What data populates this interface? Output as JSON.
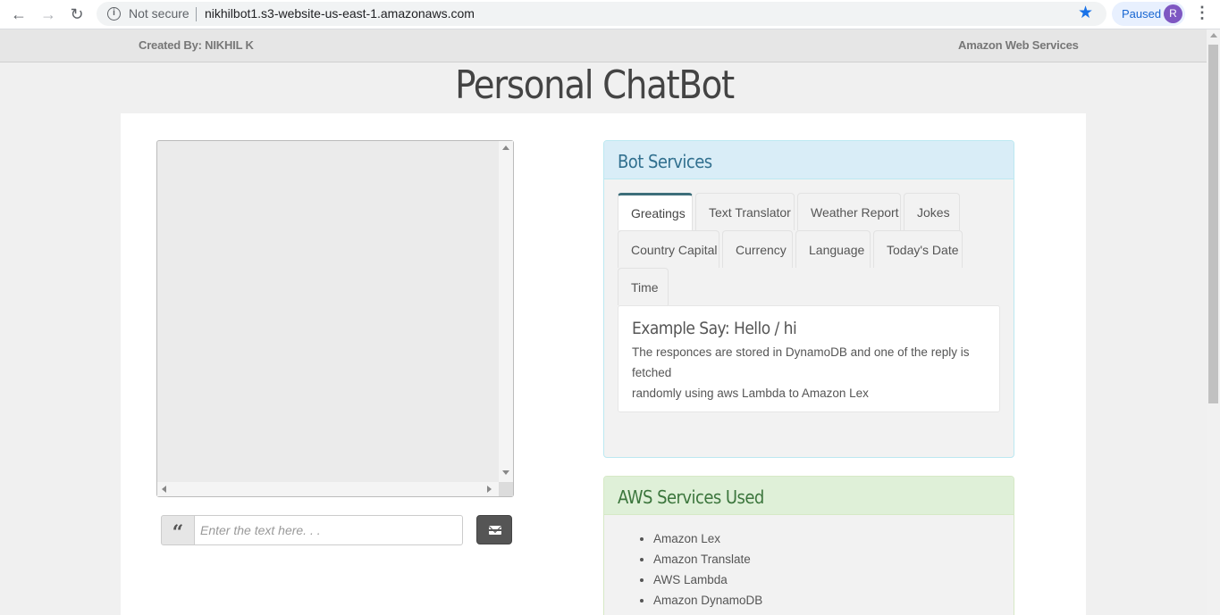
{
  "browser": {
    "security_label": "Not secure",
    "url": "nikhilbot1.s3-website-us-east-1.amazonaws.com",
    "profile_status": "Paused",
    "avatar_letter": "R"
  },
  "header": {
    "created_by": "Created By: NIKHIL K",
    "aws_link": "Amazon Web Services"
  },
  "page_title": "Personal ChatBot",
  "chat": {
    "input_placeholder": "Enter the text here. . ."
  },
  "bot_services": {
    "title": "Bot Services",
    "tabs": [
      {
        "label": "Greatings"
      },
      {
        "label": "Text Translator"
      },
      {
        "label": "Weather Report"
      },
      {
        "label": "Jokes"
      },
      {
        "label": "Country Capital"
      },
      {
        "label": "Currency"
      },
      {
        "label": "Language"
      },
      {
        "label": "Today's Date"
      },
      {
        "label": "Time"
      }
    ],
    "active_tab": "Greatings",
    "example_title": "Example Say: Hello / hi",
    "example_desc_line1": "The responces are stored in DynamoDB and one of the reply is fetched",
    "example_desc_line2": "randomly using aws Lambda to Amazon Lex"
  },
  "aws_services": {
    "title": "AWS Services Used",
    "items": [
      "Amazon Lex",
      "Amazon Translate",
      "AWS Lambda",
      "Amazon DynamoDB"
    ]
  },
  "colors": {
    "info_heading_bg": "#d9edf7",
    "success_heading_bg": "#dff0d8",
    "send_button": "#555555",
    "active_tab_accent": "#3d6e7a"
  }
}
